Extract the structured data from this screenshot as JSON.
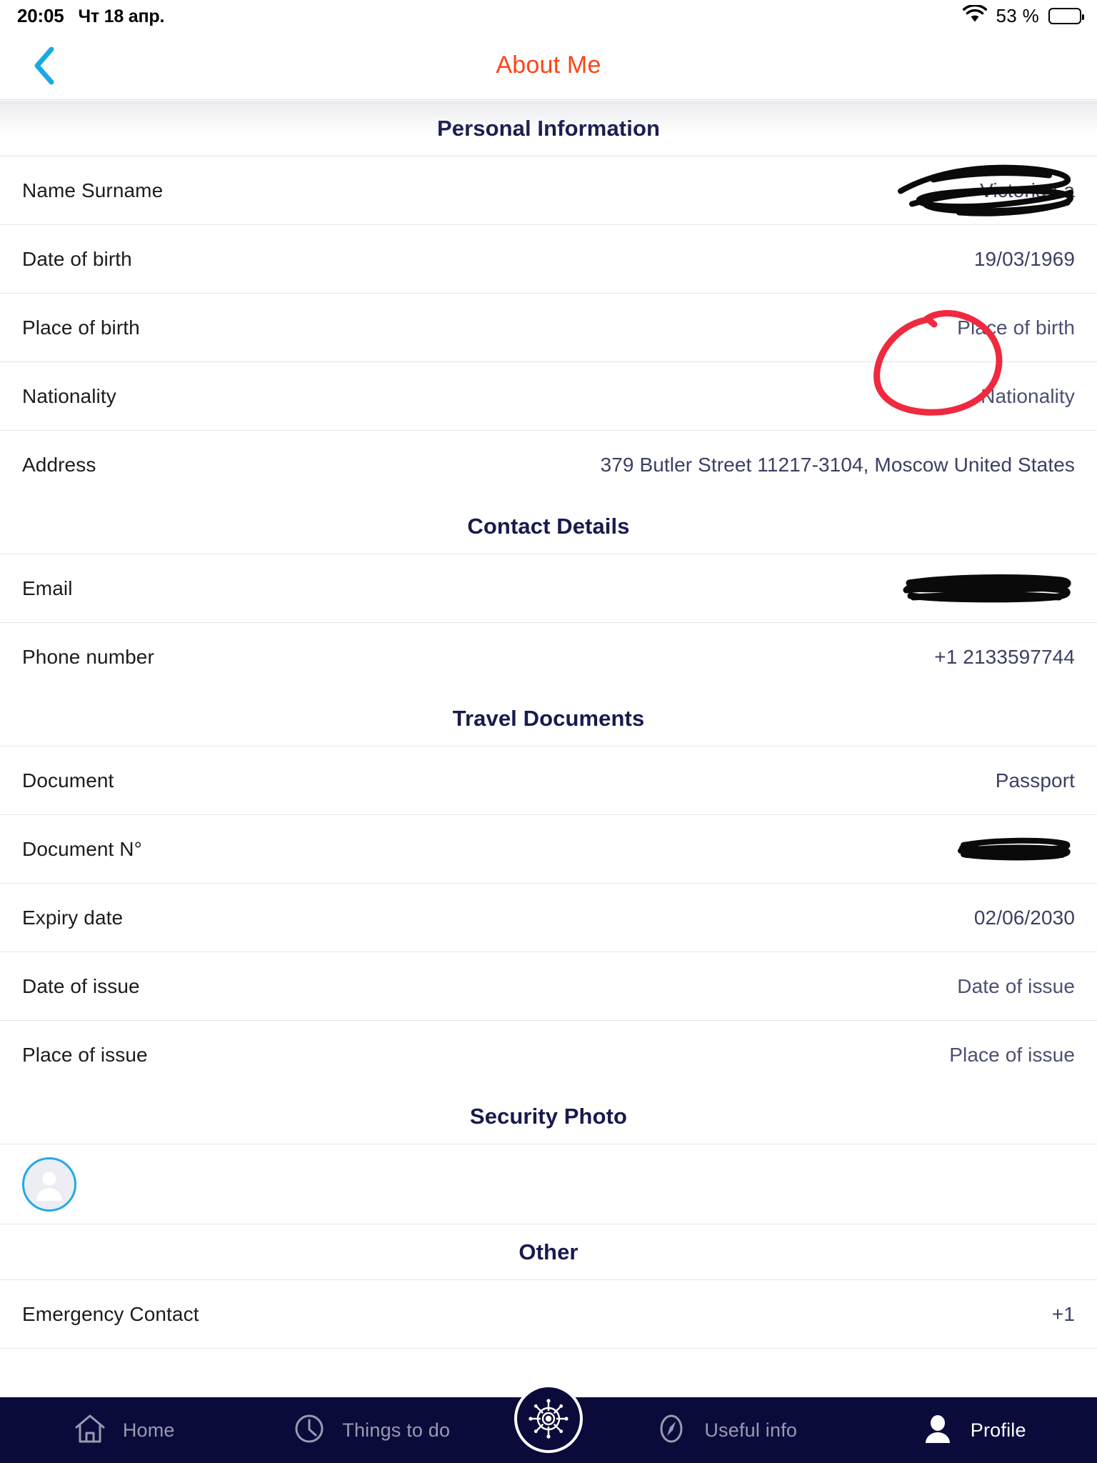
{
  "status_bar": {
    "time": "20:05",
    "date": "Чт 18 апр.",
    "battery_percent": "53 %",
    "battery_level": 53,
    "wifi_icon": "wifi-icon",
    "battery_icon": "battery-icon"
  },
  "header": {
    "title": "About Me",
    "back_icon": "chevron-left-icon",
    "title_color": "#fa4616"
  },
  "sections": [
    {
      "id": "personal-information",
      "title": "Personal Information",
      "rows": [
        {
          "label": "Name Surname",
          "value": "Victoria La",
          "redacted": true,
          "redaction_style": "scribble-heavy"
        },
        {
          "label": "Date of birth",
          "value": "19/03/1969",
          "redacted": false
        },
        {
          "label": "Place of birth",
          "value": "Place of birth",
          "redacted": false,
          "is_placeholder": true
        },
        {
          "label": "Nationality",
          "value": "Nationality",
          "redacted": false,
          "is_placeholder": true
        },
        {
          "label": "Address",
          "value": "379 Butler Street 11217-3104, Moscow United States",
          "redacted": false,
          "annotated": true
        }
      ]
    },
    {
      "id": "contact-details",
      "title": "Contact Details",
      "rows": [
        {
          "label": "Email",
          "value": "",
          "redacted": true,
          "redaction_style": "scribble-bar"
        },
        {
          "label": "Phone number",
          "value": "+1 2133597744",
          "redacted": false
        }
      ]
    },
    {
      "id": "travel-documents",
      "title": "Travel Documents",
      "rows": [
        {
          "label": "Document",
          "value": "Passport",
          "redacted": false
        },
        {
          "label": "Document N°",
          "value": "",
          "redacted": true,
          "redaction_style": "scribble-small"
        },
        {
          "label": "Expiry date",
          "value": "02/06/2030",
          "redacted": false
        },
        {
          "label": "Date of issue",
          "value": "Date of issue",
          "redacted": false,
          "is_placeholder": true
        },
        {
          "label": "Place of issue",
          "value": "Place of issue",
          "redacted": false,
          "is_placeholder": true
        }
      ]
    },
    {
      "id": "security-photo",
      "title": "Security Photo",
      "avatar": {
        "icon": "person-avatar-icon",
        "border_color": "#22aae8",
        "fill_color": "#eceef4"
      }
    },
    {
      "id": "other",
      "title": "Other",
      "rows": [
        {
          "label": "Emergency Contact",
          "value": "+1",
          "redacted": false
        }
      ]
    }
  ],
  "annotation": {
    "type": "hand-drawn-circle",
    "color": "#f0293f",
    "target": "Address value"
  },
  "bottom_nav": {
    "background": "#0b0b3b",
    "items": [
      {
        "label": "Home",
        "icon": "home-icon",
        "active": false
      },
      {
        "label": "Things to do",
        "icon": "clock-icon",
        "active": false
      },
      {
        "label": "Useful info",
        "icon": "compass-icon",
        "active": false
      },
      {
        "label": "Profile",
        "icon": "person-icon",
        "active": true
      }
    ],
    "center_button": {
      "icon": "ship-wheel-icon",
      "label": ""
    }
  }
}
